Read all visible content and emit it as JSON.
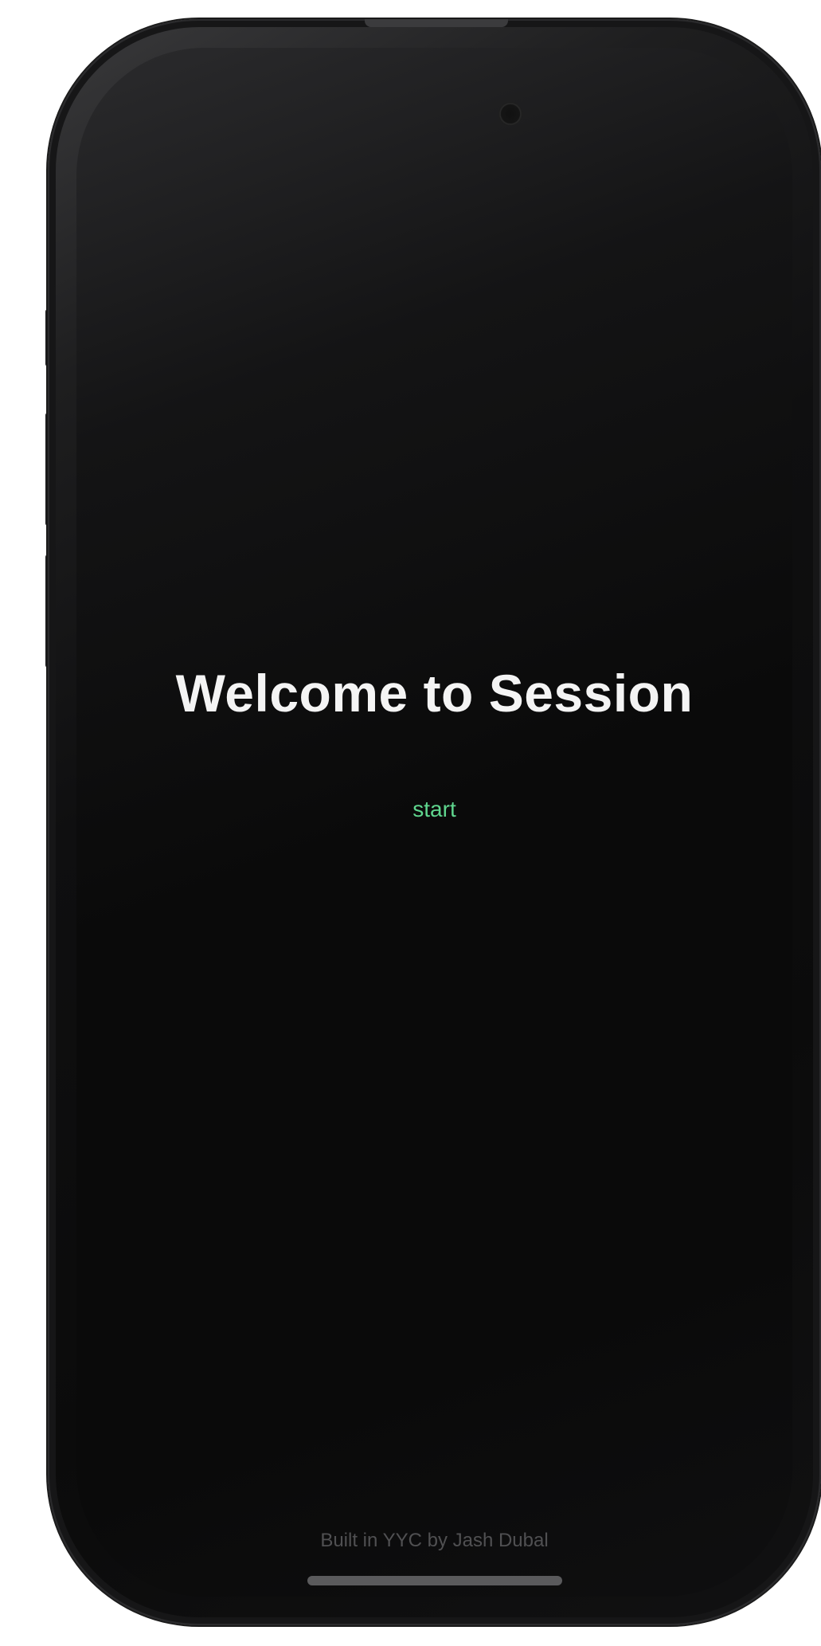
{
  "app": {
    "title": "Welcome to Session",
    "start_label": "start",
    "footer_text": "Built in YYC by Jash Dubal"
  },
  "colors": {
    "background": "#0a0a0a",
    "title_text": "#f4f4f4",
    "accent": "#5fd68e",
    "footer_text": "#505052"
  },
  "icons": {
    "camera": "front-camera-icon",
    "home_indicator": "home-indicator"
  }
}
